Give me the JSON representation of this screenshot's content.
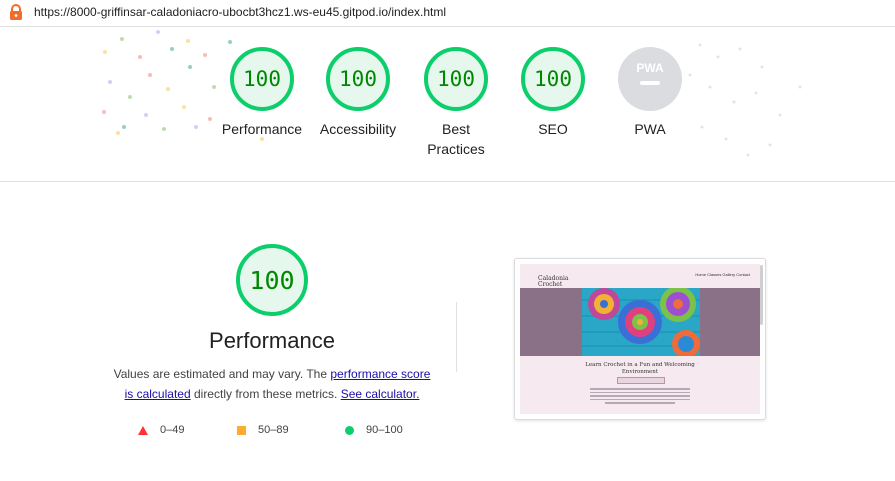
{
  "browser": {
    "url": "https://8000-griffinsar-caladoniacro-ubocbt3hcz1.ws-eu45.gitpod.io/index.html",
    "icons": {
      "lock": "lock-icon"
    }
  },
  "summary": {
    "gauges": [
      {
        "score": "100",
        "label": "Performance"
      },
      {
        "score": "100",
        "label": "Accessibility"
      },
      {
        "score": "100",
        "label_line1": "Best",
        "label_line2": "Practices"
      },
      {
        "score": "100",
        "label": "SEO"
      }
    ],
    "pwa": {
      "badge_text": "PWA",
      "label": "PWA"
    }
  },
  "performance": {
    "score": "100",
    "title": "Performance",
    "desc_prefix": "Values are estimated and may vary. The ",
    "desc_link1": "performance score is calculated",
    "desc_middle": " directly from these metrics. ",
    "desc_link2": "See calculator."
  },
  "legend": [
    {
      "shape": "triangle",
      "range": "0–49",
      "color": "#ff3333"
    },
    {
      "shape": "square",
      "range": "50–89",
      "color": "#ffaa33"
    },
    {
      "shape": "circle",
      "range": "90–100",
      "color": "#0cce6b"
    }
  ],
  "screenshot": {
    "logo_line1": "Caladonia",
    "logo_line2": "Crochet",
    "nav": "Home   Classes   Gallery   Contact",
    "heading_line1": "Learn Crochet in a Fun and Welcoming",
    "heading_line2": "Environment"
  },
  "colors": {
    "pass_green": "#0cce6b",
    "pass_text": "#008800",
    "pwa_grey": "#dadce0",
    "link": "#1a0dab"
  }
}
